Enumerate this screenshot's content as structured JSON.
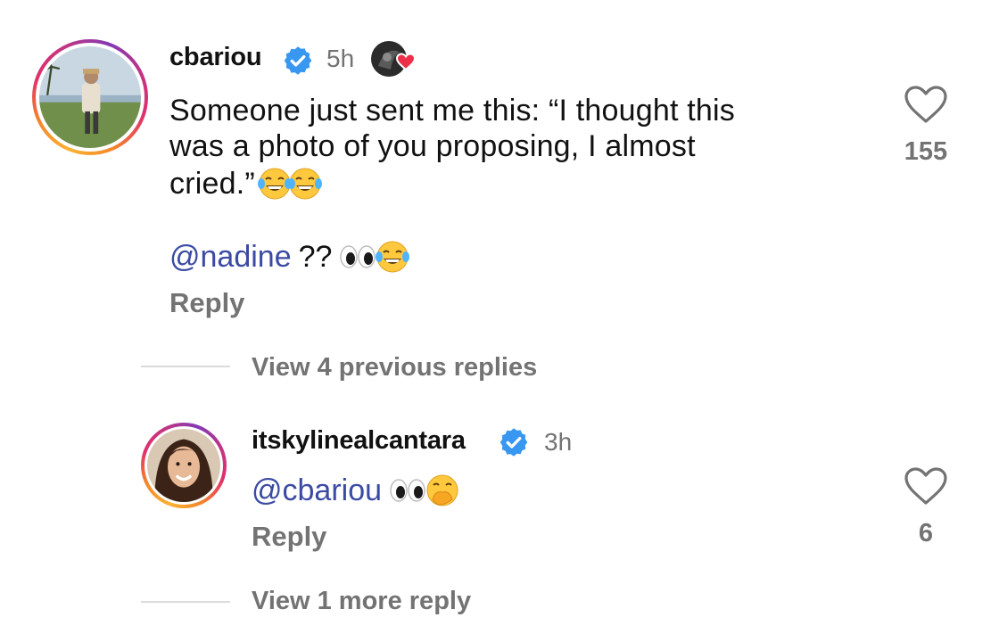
{
  "comment": {
    "username": "cbariou",
    "time": "5h",
    "text_line1": "Someone just sent me this: “I thought this",
    "text_line2": "was a photo of you proposing, I almost",
    "text_line3": "cried.”",
    "emoji_line3": [
      "face-with-tears-of-joy",
      "face-with-tears-of-joy"
    ],
    "mention": "@nadine",
    "mention_suffix": "??",
    "mention_emojis": [
      "eyes",
      "face-with-tears-of-joy"
    ],
    "reply_label": "Reply",
    "like_count": "155"
  },
  "view_previous": {
    "label": "View 4 previous replies"
  },
  "reply": {
    "username": "itskylinealcantara",
    "time": "3h",
    "mention": "@cbariou",
    "mention_emojis": [
      "eyes",
      "face-with-hand-over-mouth"
    ],
    "reply_label": "Reply",
    "like_count": "6"
  },
  "view_more": {
    "label": "View 1 more reply"
  },
  "colors": {
    "mention": "#3b4ba3",
    "verified": "#3897f0",
    "muted": "#737373",
    "heart_red": "#ed2f47"
  }
}
